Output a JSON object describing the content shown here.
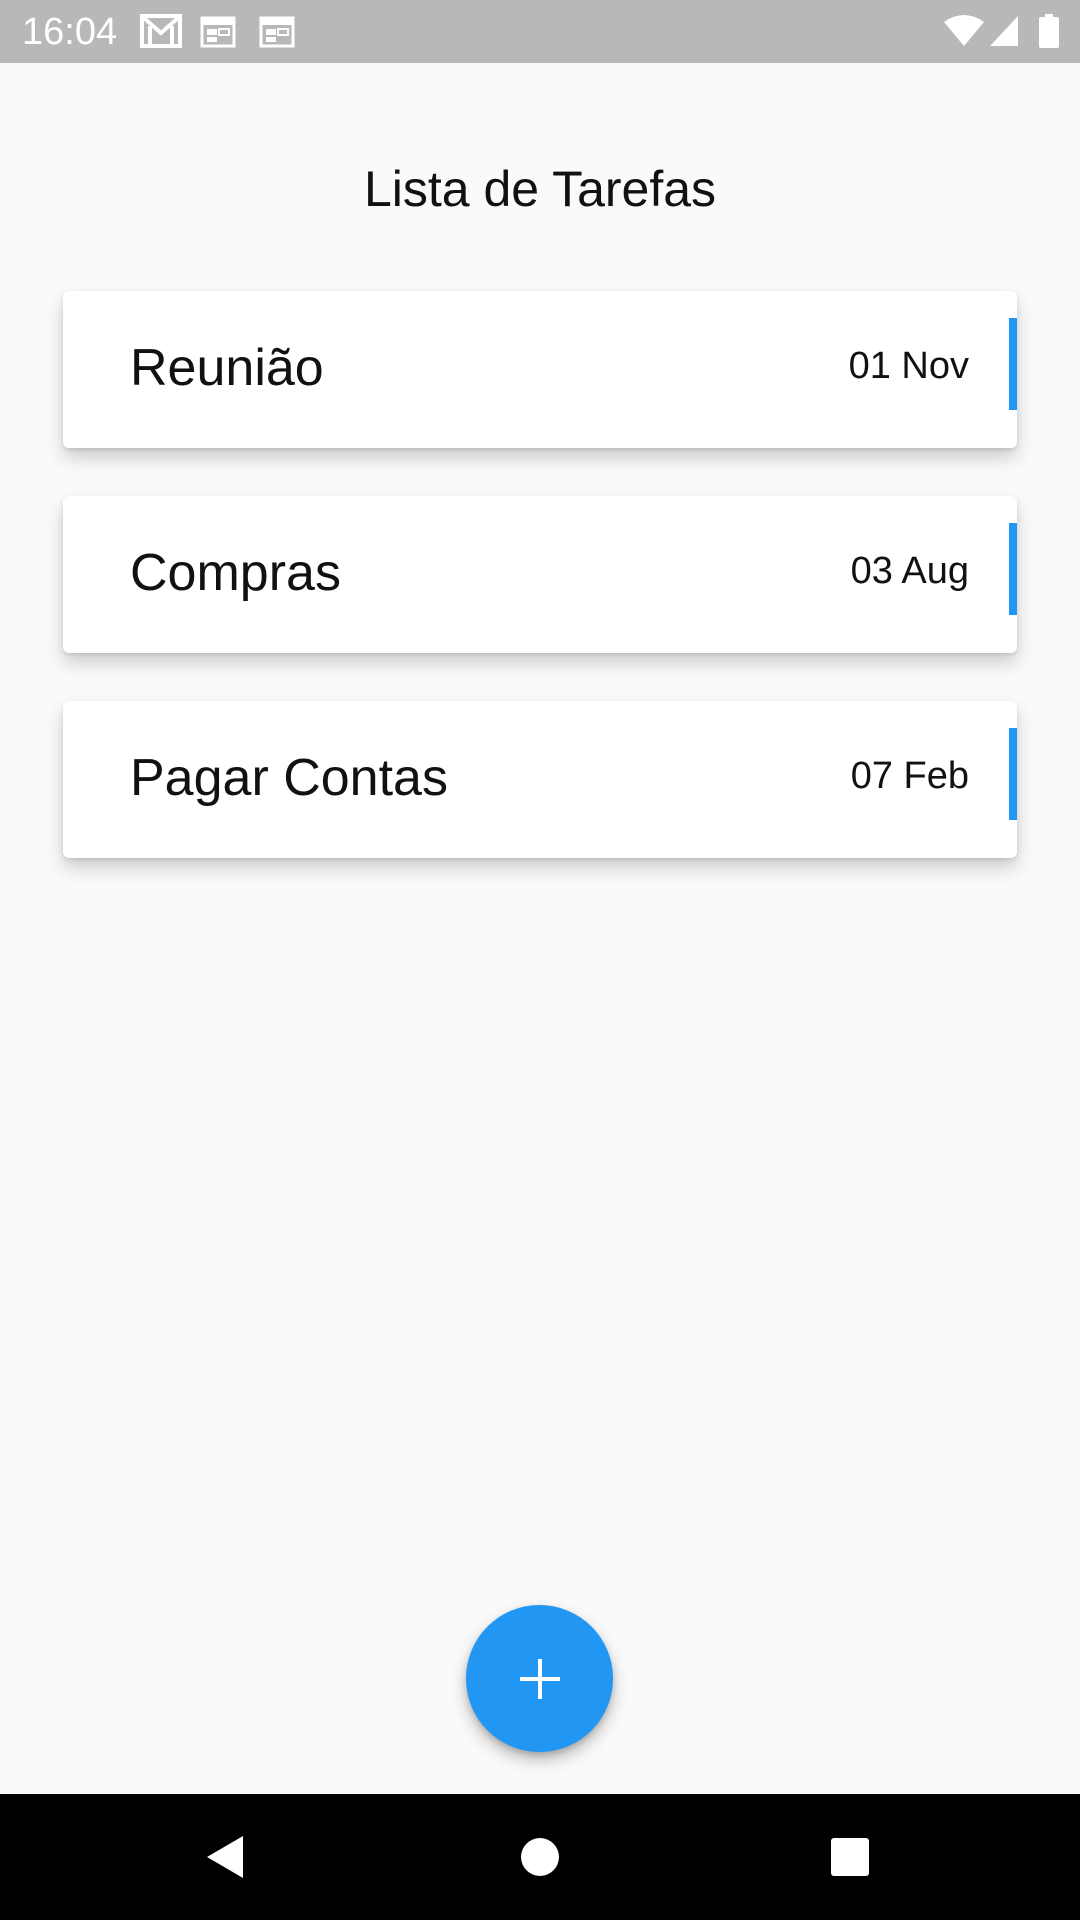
{
  "status_bar": {
    "time": "16:04",
    "icons": [
      "gmail-icon",
      "calendar-icon",
      "calendar-icon",
      "wifi-icon",
      "signal-icon",
      "battery-icon"
    ]
  },
  "page": {
    "title": "Lista de Tarefas"
  },
  "tasks": [
    {
      "name": "Reunião",
      "date": "01 Nov"
    },
    {
      "name": "Compras",
      "date": "03 Aug"
    },
    {
      "name": "Pagar Contas",
      "date": "07 Feb"
    }
  ],
  "fab": {
    "icon": "plus-icon"
  },
  "navigation": {
    "buttons": [
      "back-icon",
      "home-icon",
      "recents-icon"
    ]
  },
  "colors": {
    "accent": "#2196f3",
    "status_bar": "#b8b8b8",
    "background": "#fafafa",
    "nav_bar": "#000000"
  }
}
